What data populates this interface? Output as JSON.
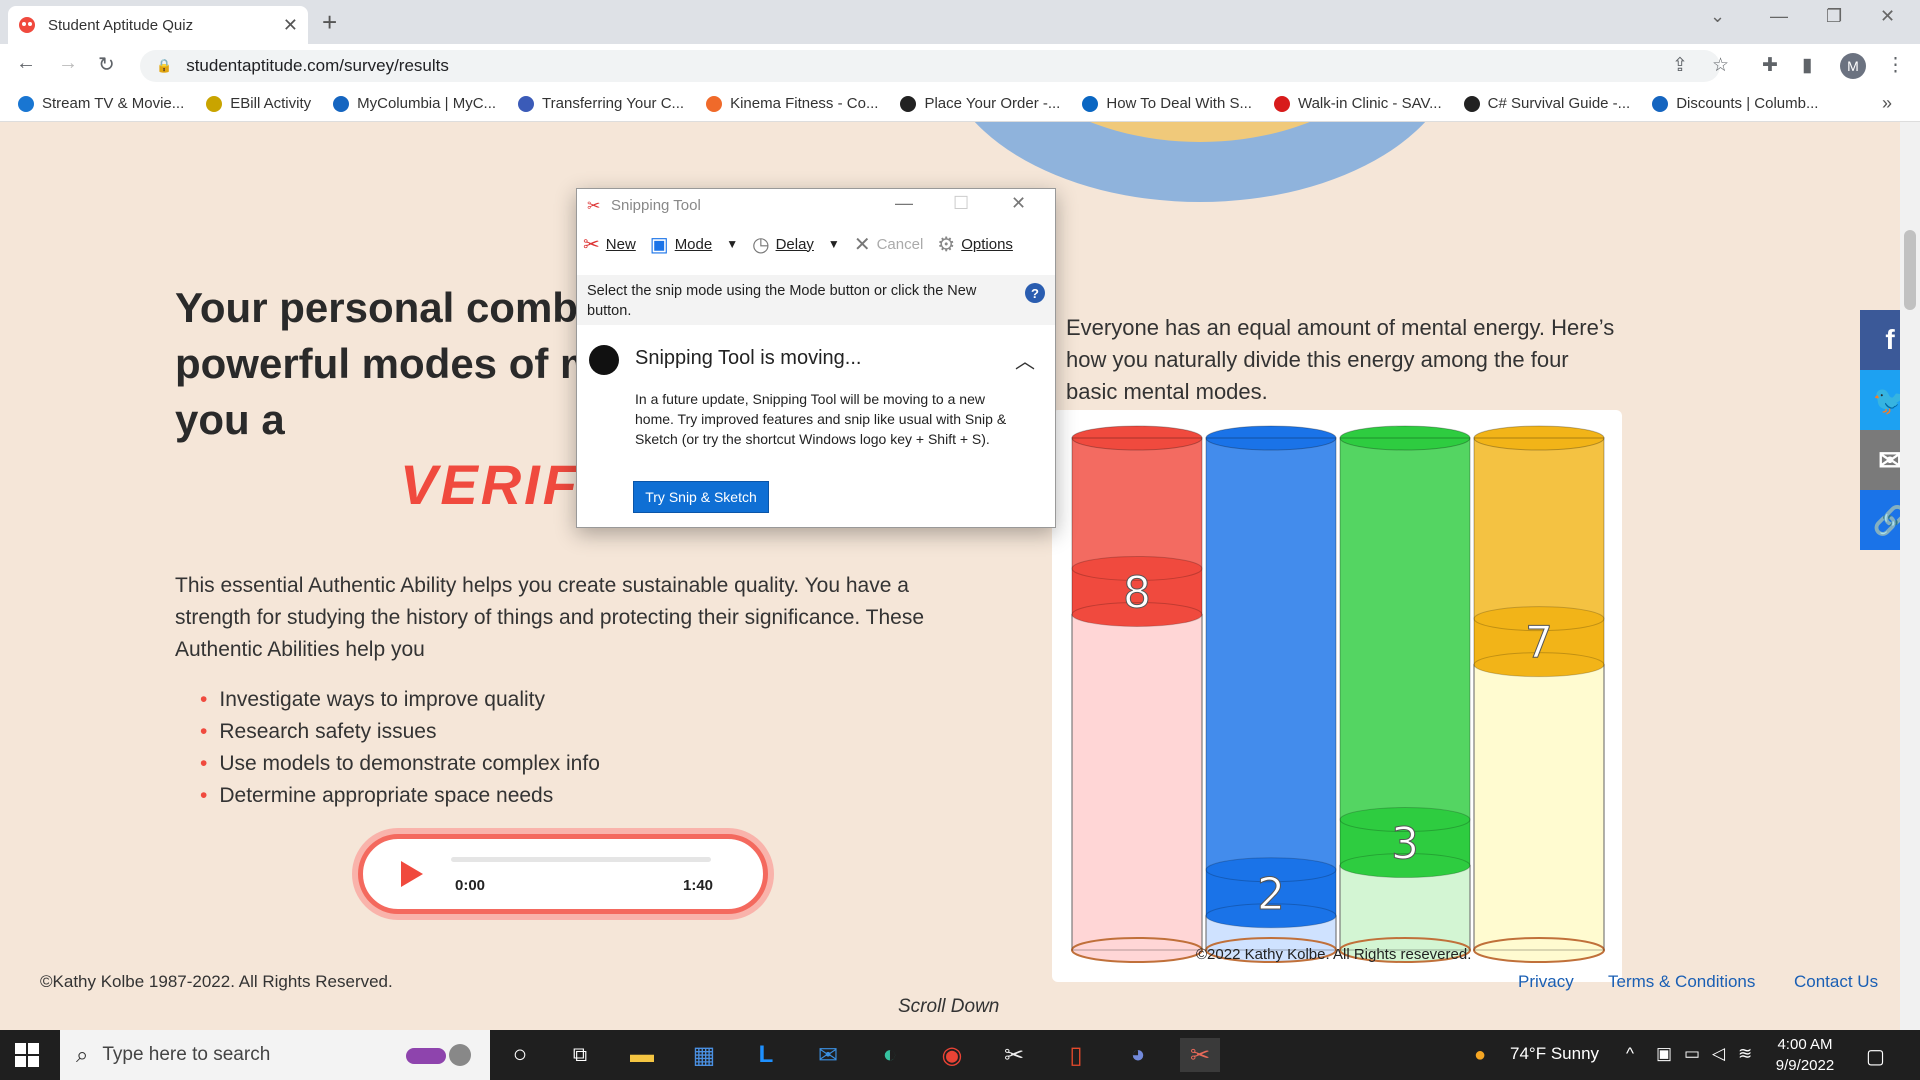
{
  "browser": {
    "tab_title": "Student Aptitude Quiz",
    "url": "studentaptitude.com/survey/results",
    "avatar_letter": "M",
    "bookmarks": [
      {
        "label": "Stream TV & Movie...",
        "icon": "d-icon",
        "color": "#1976d2"
      },
      {
        "label": "EBill Activity",
        "icon": "n-icon",
        "color": "#c9a400"
      },
      {
        "label": "MyColumbia | MyC...",
        "icon": "c-icon",
        "color": "#1565c0"
      },
      {
        "label": "Transferring Your C...",
        "icon": "shield-icon",
        "color": "#3b5bb8"
      },
      {
        "label": "Kinema Fitness - Co...",
        "icon": "stripes-icon",
        "color": "#f06a2a"
      },
      {
        "label": "Place Your Order -...",
        "icon": "amazon-icon",
        "color": "#222"
      },
      {
        "label": "How To Deal With S...",
        "icon": "linkedin-icon",
        "color": "#0a66c2"
      },
      {
        "label": "Walk-in Clinic - SAV...",
        "icon": "heart-icon",
        "color": "#d81b1b"
      },
      {
        "label": "C# Survival Guide -...",
        "icon": "vs-icon",
        "color": "#222"
      },
      {
        "label": "Discounts | Columb...",
        "icon": "c-icon",
        "color": "#1565c0"
      }
    ]
  },
  "page": {
    "headline": "Your personal combi",
    "headline_line2": "powerful modes of m",
    "headline_line3": "you a",
    "type_word": "VERIF",
    "description": "This essential Authentic Ability helps you create sustainable quality. You have a strength for studying the history of things and protecting their significance. These Authentic Abilities help you",
    "abilities": [
      "Investigate ways to improve quality",
      "Research safety issues",
      "Use models to demonstrate complex info",
      "Determine appropriate space needs"
    ],
    "audio": {
      "current": "0:00",
      "total": "1:40",
      "progress": 0
    },
    "energy_text": "Everyone has an equal amount of mental energy. Here’s how you naturally divide this energy among the four basic mental modes.",
    "footer_copyright": "©Kathy Kolbe 1987-2022. All Rights Reserved.",
    "scroll_down": "Scroll Down",
    "footer_links": [
      "Privacy",
      "Terms & Conditions",
      "Contact Us"
    ],
    "share": [
      {
        "icon": "facebook-icon",
        "glyph": "f",
        "color": "#3b5998"
      },
      {
        "icon": "twitter-icon",
        "glyph": "🐦",
        "color": "#1da1f2"
      },
      {
        "icon": "email-icon",
        "glyph": "✉",
        "color": "#7a7a7a"
      },
      {
        "icon": "link-icon",
        "glyph": "🔗",
        "color": "#1a73e8"
      }
    ]
  },
  "chart_data": {
    "type": "bar",
    "categories": [
      "",
      "",
      "",
      ""
    ],
    "values": [
      8,
      2,
      3,
      7
    ],
    "ylim": [
      10,
      1
    ],
    "colors": [
      "#f04a3e",
      "#1a73e8",
      "#2ecc40",
      "#f2b418"
    ],
    "light_colors": [
      "#ffd6d6",
      "#cfe2ff",
      "#d3f5d3",
      "#fffbd0"
    ],
    "copyright": "©2022 Kathy Kolbe. All Rights resevered."
  },
  "snipping_tool": {
    "title": "Snipping Tool",
    "toolbar": {
      "new": "New",
      "mode": "Mode",
      "delay": "Delay",
      "cancel": "Cancel",
      "options": "Options"
    },
    "info": "Select the snip mode using the Mode button or click the New button.",
    "moving_title": "Snipping Tool is moving...",
    "moving_body": "In a future update, Snipping Tool will be moving to a new home. Try improved features and snip like usual with Snip & Sketch (or try the shortcut Windows logo key + Shift + S).",
    "try_button": "Try Snip & Sketch"
  },
  "taskbar": {
    "search_placeholder": "Type here to search",
    "weather": "74°F  Sunny",
    "time": "4:00 AM",
    "date": "9/9/2022"
  }
}
